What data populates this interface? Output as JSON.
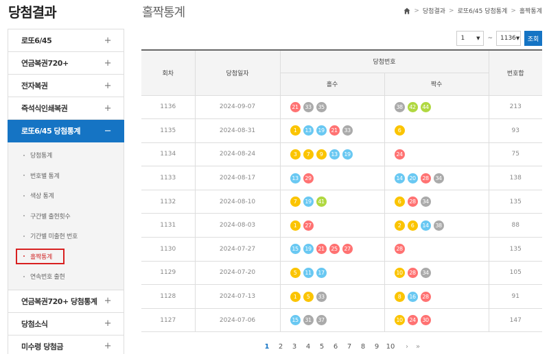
{
  "header": {
    "section_title": "당첨결과",
    "page_title": "홀짝통계",
    "breadcrumb": [
      "당첨결과",
      "로또6/45 당첨통계",
      "홀짝통계"
    ],
    "breadcrumb_sep": ">"
  },
  "sidebar": {
    "items": [
      {
        "label": "로또6/45",
        "toggle": "+"
      },
      {
        "label": "연금복권720+",
        "toggle": "+"
      },
      {
        "label": "전자복권",
        "toggle": "+"
      },
      {
        "label": "즉석식인쇄복권",
        "toggle": "+"
      },
      {
        "label": "로또6/45 당첨통계",
        "toggle": "−"
      },
      {
        "label": "연금복권720+ 당첨통계",
        "toggle": "+"
      },
      {
        "label": "당첨소식",
        "toggle": "+"
      },
      {
        "label": "미수령 당첨금",
        "toggle": "+"
      }
    ],
    "subitems": [
      "당첨통계",
      "번호별 통계",
      "색상 통계",
      "구간별 출현횟수",
      "기간별 미출현 번호",
      "홀짝통계",
      "연속번호 출현"
    ]
  },
  "controls": {
    "from_value": "1",
    "tilde": "~",
    "to_value": "1136",
    "search_label": "조회"
  },
  "table": {
    "headers": {
      "round": "회차",
      "date": "당첨일자",
      "numbers": "당첨번호",
      "odd": "홀수",
      "even": "짝수",
      "sum": "번호합"
    },
    "rows": [
      {
        "round": "1136",
        "date": "2024-09-07",
        "odd": [
          21,
          33,
          35
        ],
        "even": [
          38,
          42,
          44
        ],
        "sum": "213"
      },
      {
        "round": "1135",
        "date": "2024-08-31",
        "odd": [
          1,
          13,
          19,
          21,
          33
        ],
        "even": [
          6
        ],
        "sum": "93"
      },
      {
        "round": "1134",
        "date": "2024-08-24",
        "odd": [
          3,
          7,
          9,
          13,
          19
        ],
        "even": [
          24
        ],
        "sum": "75"
      },
      {
        "round": "1133",
        "date": "2024-08-17",
        "odd": [
          13,
          29
        ],
        "even": [
          14,
          20,
          28,
          34
        ],
        "sum": "138"
      },
      {
        "round": "1132",
        "date": "2024-08-10",
        "odd": [
          7,
          19,
          41
        ],
        "even": [
          6,
          28,
          34
        ],
        "sum": "135"
      },
      {
        "round": "1131",
        "date": "2024-08-03",
        "odd": [
          1,
          27
        ],
        "even": [
          2,
          6,
          14,
          38
        ],
        "sum": "88"
      },
      {
        "round": "1130",
        "date": "2024-07-27",
        "odd": [
          15,
          19,
          21,
          25,
          27
        ],
        "even": [
          28
        ],
        "sum": "135"
      },
      {
        "round": "1129",
        "date": "2024-07-20",
        "odd": [
          5,
          11,
          17
        ],
        "even": [
          10,
          28,
          34
        ],
        "sum": "105"
      },
      {
        "round": "1128",
        "date": "2024-07-13",
        "odd": [
          1,
          5,
          33
        ],
        "even": [
          8,
          16,
          28
        ],
        "sum": "91"
      },
      {
        "round": "1127",
        "date": "2024-07-06",
        "odd": [
          15,
          31,
          37
        ],
        "even": [
          10,
          24,
          30
        ],
        "sum": "147"
      }
    ]
  },
  "ball_colors": {
    "1-10": "#fbc400",
    "11-20": "#69c8f2",
    "21-30": "#ff7272",
    "31-40": "#aaaaaa",
    "41-45": "#b0d840"
  },
  "pagination": {
    "pages": [
      "1",
      "2",
      "3",
      "4",
      "5",
      "6",
      "7",
      "8",
      "9",
      "10"
    ],
    "current": "1",
    "next": "›",
    "last": "»"
  },
  "colors": {
    "accent": "#1574c4",
    "highlight_box": "#d81f1f"
  }
}
